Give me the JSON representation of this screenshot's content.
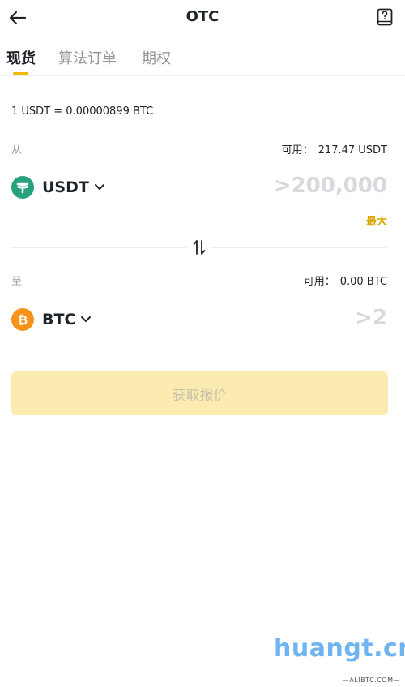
{
  "header": {
    "title": "OTC",
    "back_icon": "arrow-left-icon",
    "book_icon": "book-question-icon"
  },
  "tabs": [
    {
      "label": "现货",
      "active": true
    },
    {
      "label": "算法订单",
      "active": false
    },
    {
      "label": "期权",
      "active": false
    }
  ],
  "rate": "1 USDT = 0.00000899 BTC",
  "from": {
    "label": "从",
    "available_label": "可用：",
    "available_value": "217.47 USDT",
    "coin": "USDT",
    "amount_placeholder": ">200,000",
    "max_label": "最大"
  },
  "to": {
    "label": "至",
    "available_label": "可用：",
    "available_value": "0.00 BTC",
    "coin": "BTC",
    "amount_placeholder": ">2"
  },
  "submit_label": "获取报价",
  "watermark": {
    "text": "huangt.cn",
    "sub": "—ALIBTC.COM—"
  },
  "colors": {
    "accent": "#f0b90b",
    "usdt": "#26a17b",
    "btc": "#f7931a",
    "button_disabled": "#fcebb0"
  }
}
